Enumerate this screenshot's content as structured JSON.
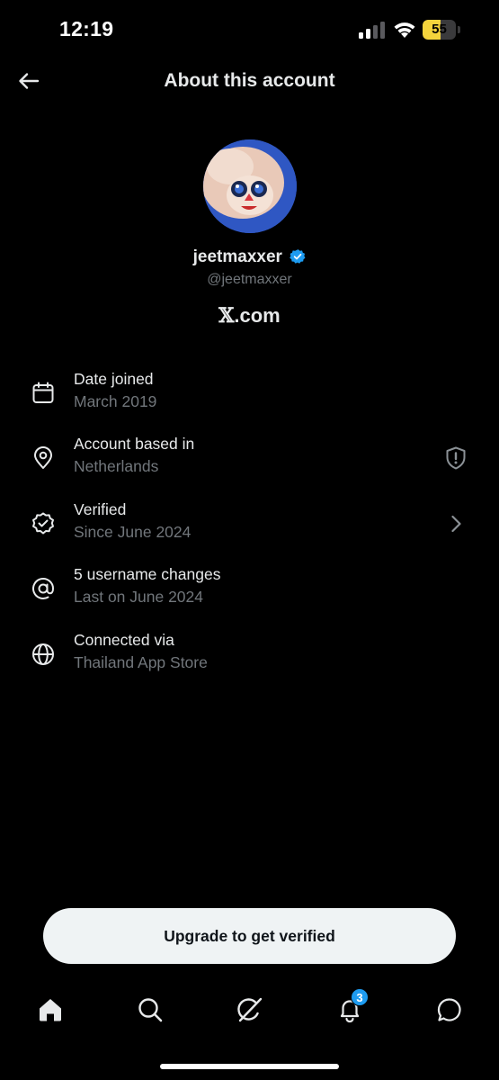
{
  "status_bar": {
    "time": "12:19",
    "battery_level": "55",
    "battery_fraction": 0.55
  },
  "header": {
    "title": "About this account",
    "back_icon": "arrow-left-icon"
  },
  "profile": {
    "display_name": "jeetmaxxer",
    "handle": "@jeetmaxxer",
    "site_glyph": "𝕏",
    "site_suffix": ".com",
    "verified_color": "#1d9bf0",
    "avatar_bg": "#2f57c3"
  },
  "info": {
    "date_joined": {
      "title": "Date joined",
      "value": "March 2019",
      "icon": "calendar-icon"
    },
    "based_in": {
      "title": "Account based in",
      "value": "Netherlands",
      "icon": "location-pin-icon",
      "trail_icon": "shield-alert-icon"
    },
    "verified": {
      "title": "Verified",
      "value": "Since June 2024",
      "icon": "verified-badge-icon",
      "trail_icon": "chevron-right-icon"
    },
    "username_changes": {
      "title": "5 username changes",
      "value": "Last on June 2024",
      "icon": "at-sign-icon"
    },
    "connected_via": {
      "title": "Connected via",
      "value": "Thailand App Store",
      "icon": "globe-icon"
    }
  },
  "upgrade_button_label": "Upgrade to get verified",
  "bottom_nav": {
    "items": [
      "home-icon",
      "search-icon",
      "grok-icon",
      "bell-icon",
      "messages-icon"
    ],
    "notifications_count": "3"
  },
  "colors": {
    "background": "#000000",
    "primary_text": "#e7e9ea",
    "secondary_text": "#71767b",
    "accent": "#1d9bf0",
    "battery": "#f4d33c"
  }
}
